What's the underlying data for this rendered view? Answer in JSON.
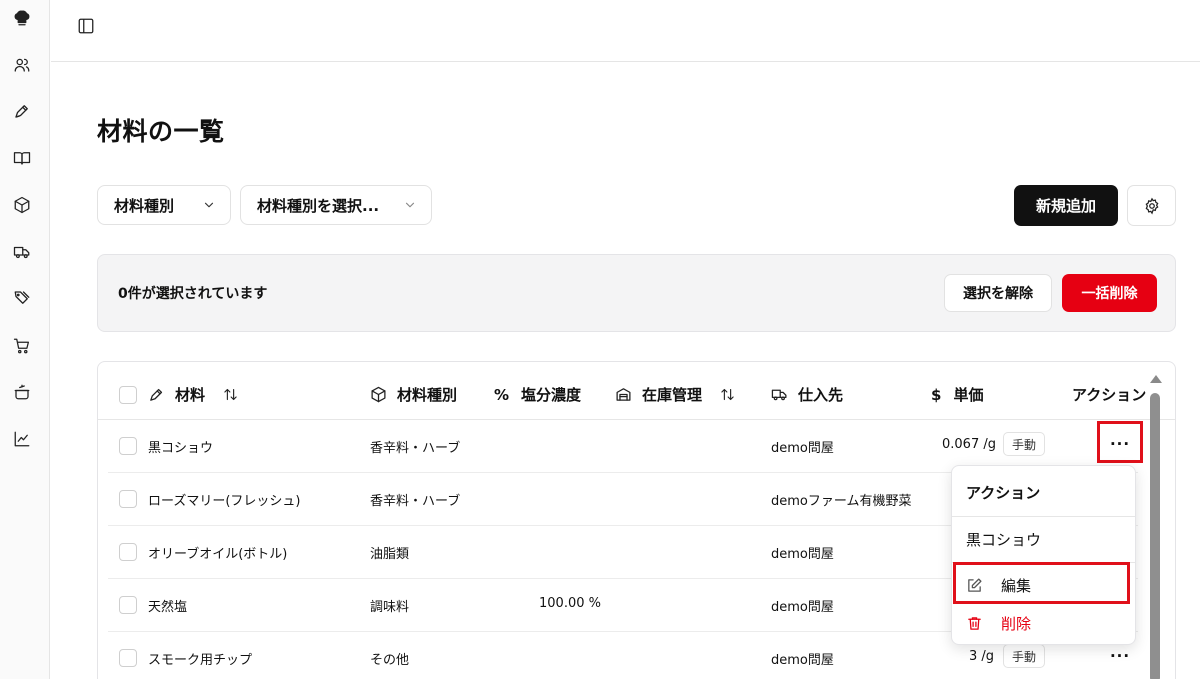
{
  "sidebar": {
    "items": [
      {
        "icon": "chef-hat-icon"
      },
      {
        "icon": "users-icon"
      },
      {
        "icon": "pen-icon"
      },
      {
        "icon": "book-icon"
      },
      {
        "icon": "package-icon"
      },
      {
        "icon": "truck-icon"
      },
      {
        "icon": "tags-icon"
      },
      {
        "icon": "cart-icon"
      },
      {
        "icon": "pot-icon"
      },
      {
        "icon": "chart-icon"
      }
    ]
  },
  "page": {
    "title": "材料の一覧"
  },
  "filters": {
    "type_label": "材料種別",
    "choose_placeholder": "材料種別を選択..."
  },
  "toolbar": {
    "add_label": "新規追加"
  },
  "selection": {
    "count_text": "0件が選択されています",
    "clear_label": "選択を解除",
    "bulk_delete_label": "一括削除"
  },
  "table": {
    "columns": {
      "name": "材料",
      "type": "材料種別",
      "salt": "塩分濃度",
      "stock": "在庫管理",
      "supplier": "仕入先",
      "price": "単価",
      "actions": "アクション"
    },
    "rows": [
      {
        "name": "黒コショウ",
        "type": "香辛料・ハーブ",
        "salt": "",
        "supplier": "demo問屋",
        "price": "0.067 /g",
        "badge": "手動"
      },
      {
        "name": "ローズマリー(フレッシュ)",
        "type": "香辛料・ハーブ",
        "salt": "",
        "supplier": "demoファーム有機野菜",
        "price": "",
        "badge": ""
      },
      {
        "name": "オリーブオイル(ボトル)",
        "type": "油脂類",
        "salt": "",
        "supplier": "demo問屋",
        "price": "",
        "badge": ""
      },
      {
        "name": "天然塩",
        "type": "調味料",
        "salt": "100.00 %",
        "supplier": "demo問屋",
        "price": "",
        "badge": ""
      },
      {
        "name": "スモーク用チップ",
        "type": "その他",
        "salt": "",
        "supplier": "demo問屋",
        "price": "3 /g",
        "badge": "手動"
      }
    ],
    "glyphs": {
      "percent": "%",
      "dollar": "$",
      "more": "···"
    }
  },
  "menu": {
    "label": "アクション",
    "item_name": "黒コショウ",
    "edit_label": "編集",
    "delete_label": "削除"
  },
  "colors": {
    "primary": "#111111",
    "danger": "#e60012",
    "highlight": "#e0101a"
  }
}
